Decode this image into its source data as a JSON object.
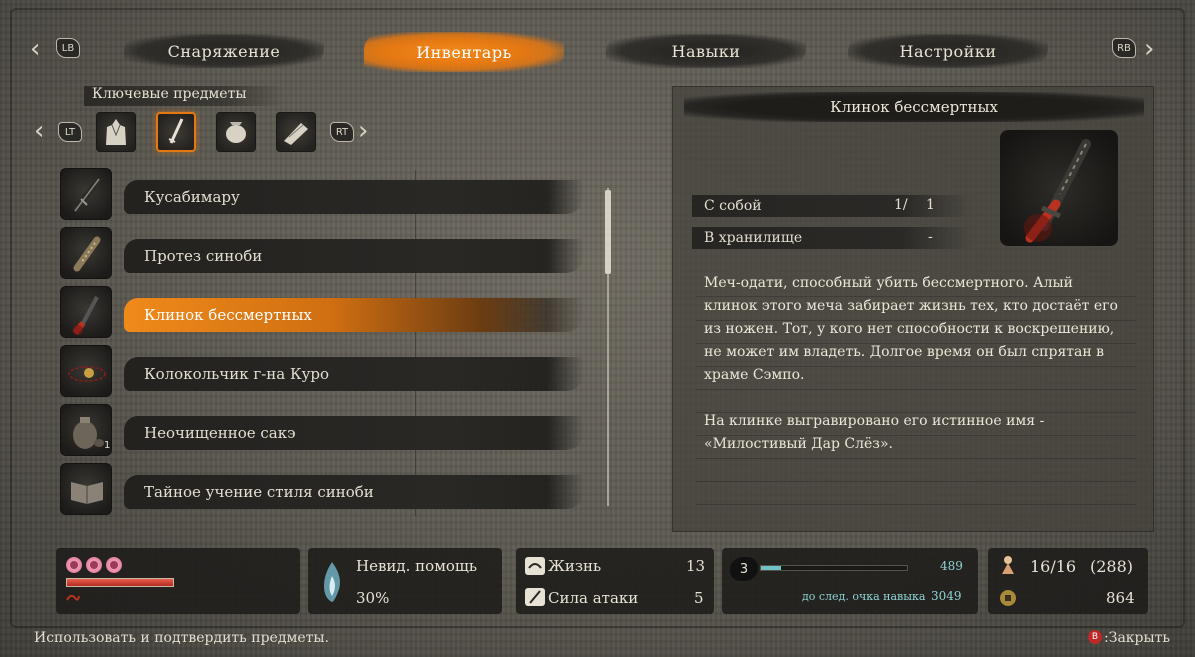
{
  "tabs": [
    {
      "label": "Снаряжение",
      "active": false
    },
    {
      "label": "Инвентарь",
      "active": true
    },
    {
      "label": "Навыки",
      "active": false
    },
    {
      "label": "Настройки",
      "active": false
    }
  ],
  "hints": {
    "lb": "LB",
    "rb": "RB",
    "lt": "LT",
    "rt": "RT"
  },
  "category": {
    "title": "Ключевые предметы",
    "icons": [
      "outfit-icon",
      "sword-icon",
      "pouch-icon",
      "scroll-icon"
    ]
  },
  "items": [
    {
      "label": "Кусабимару",
      "icon": "katana-icon"
    },
    {
      "label": "Протез синоби",
      "icon": "prosthetic-arm-icon"
    },
    {
      "label": "Клинок бессмертных",
      "icon": "red-blade-icon",
      "selected": true
    },
    {
      "label": "Колокольчик г-на Куро",
      "icon": "bell-charm-icon"
    },
    {
      "label": "Неочищенное сакэ",
      "icon": "sake-jar-icon",
      "count": "1"
    },
    {
      "label": "Тайное учение стиля синоби",
      "icon": "book-icon"
    }
  ],
  "detail": {
    "title": "Клинок бессмертных",
    "carried_label": "С собой",
    "carried_value": "1/",
    "carried_max": "1",
    "storage_label": "В хранилище",
    "storage_value": "-",
    "description_1": "Меч-одати, способный убить бессмертного. Алый клинок этого меча забирает жизнь тех, кто достаёт его из ножен. Тот, у кого нет способности к воскрешению, не может им владеть. Долгое время он был спрятан в храме Сэмпо.",
    "description_2": "На клинке выгравировано его истинное имя - «Милостивый Дар Слёз»."
  },
  "hud": {
    "hp_fraction": 1.0,
    "unseen_aid_label": "Невид. помощь",
    "unseen_aid_value": "30%",
    "vitality_label": "Жизнь",
    "vitality_value": "13",
    "attack_label": "Сила атаки",
    "attack_value": "5",
    "skill_points": "3",
    "exp_value": "489",
    "exp_progress": 0.14,
    "next_point_label": "до след. очка навыка",
    "next_point_value": "3049",
    "spirit_emblems": "16/16",
    "spirit_emblems_reserve": "(288)",
    "sen": "864"
  },
  "footer": {
    "hint": "Использовать и подтвердить предметы.",
    "close_button": "B",
    "close_label": ":Закрыть"
  },
  "colors": {
    "accent": "#e47812",
    "hp": "#b42a20",
    "exp": "#6fc3c6"
  }
}
